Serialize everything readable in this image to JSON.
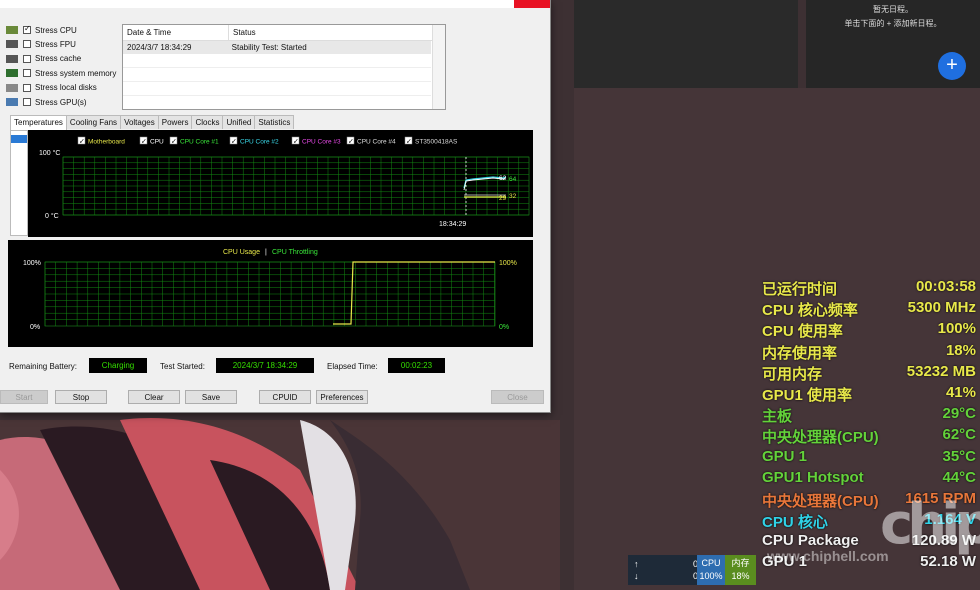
{
  "calendar": {
    "line1": "暂无日程。",
    "line2": "单击下面的 + 添加新日程。",
    "add_label": "+"
  },
  "overlay": {
    "rows": [
      {
        "label": "已运行时间",
        "value": "00:03:58",
        "color": "#e8e84a"
      },
      {
        "label": "CPU 核心频率",
        "value": "5300 MHz",
        "color": "#e8e84a"
      },
      {
        "label": "CPU 使用率",
        "value": "100%",
        "color": "#e8e84a"
      },
      {
        "label": "内存使用率",
        "value": "18%",
        "color": "#e8e84a"
      },
      {
        "label": "可用内存",
        "value": "53232 MB",
        "color": "#e8e84a"
      },
      {
        "label": "GPU1 使用率",
        "value": "41%",
        "color": "#e8e84a"
      },
      {
        "label": "主板",
        "value": "29°C",
        "color": "#63d23a"
      },
      {
        "label": "中央处理器(CPU)",
        "value": "62°C",
        "color": "#63d23a"
      },
      {
        "label": "GPU 1",
        "value": "35°C",
        "color": "#63d23a"
      },
      {
        "label": "GPU1 Hotspot",
        "value": "44°C",
        "color": "#63d23a"
      },
      {
        "label": "中央处理器(CPU)",
        "value": "1615 RPM",
        "color": "#e8763a"
      },
      {
        "label": "CPU 核心",
        "value": "1.164 V",
        "color": "#2fd3e8"
      },
      {
        "label": "CPU Package",
        "value": "120.89 W",
        "color": "#f0f0f0"
      },
      {
        "label": "GPU 1",
        "value": "52.18 W",
        "color": "#f0f0f0"
      }
    ]
  },
  "tray": {
    "up": "0.0M/s",
    "down": "0.0M/s",
    "cpu_label": "CPU",
    "cpu_value": "100%",
    "mem_label": "内存",
    "mem_value": "18%"
  },
  "watermark": {
    "url": "www.chiphell.com",
    "logo": "chip"
  },
  "stress": [
    {
      "label": "Stress CPU",
      "checked": true
    },
    {
      "label": "Stress FPU",
      "checked": false
    },
    {
      "label": "Stress cache",
      "checked": false
    },
    {
      "label": "Stress system memory",
      "checked": false
    },
    {
      "label": "Stress local disks",
      "checked": false
    },
    {
      "label": "Stress GPU(s)",
      "checked": false
    }
  ],
  "status_table": {
    "headers": [
      "Date & Time",
      "Status"
    ],
    "rows": [
      [
        "2024/3/7 18:34:29",
        "Stability Test: Started"
      ]
    ]
  },
  "tabs": [
    "Temperatures",
    "Cooling Fans",
    "Voltages",
    "Powers",
    "Clocks",
    "Unified",
    "Statistics"
  ],
  "temp_chart": {
    "legend": [
      {
        "name": "Motherboard",
        "color": "#e8e84a"
      },
      {
        "name": "CPU",
        "color": "#ffffff"
      },
      {
        "name": "CPU Core #1",
        "color": "#3ae83a"
      },
      {
        "name": "CPU Core #2",
        "color": "#3ad8e8"
      },
      {
        "name": "CPU Core #3",
        "color": "#e84ae8"
      },
      {
        "name": "CPU Core #4",
        "color": "#dddddd"
      },
      {
        "name": "ST3500418AS",
        "color": "#dddddd"
      }
    ],
    "ymax_label": "100 °C",
    "ymin_label": "0 °C",
    "time_label": "18:34:29",
    "values_right": [
      "62",
      "64",
      "29",
      "32"
    ]
  },
  "usage_chart": {
    "legend_a": "CPU Usage",
    "legend_sep": "|",
    "legend_b": "CPU Throttling",
    "left_top": "100%",
    "left_bottom": "0%",
    "right_top": "100%",
    "right_bottom": "0%"
  },
  "bottom": {
    "battery_label": "Remaining Battery:",
    "battery_value": "Charging",
    "started_label": "Test Started:",
    "started_value": "2024/3/7 18:34:29",
    "elapsed_label": "Elapsed Time:",
    "elapsed_value": "00:02:23"
  },
  "buttons": {
    "start": "Start",
    "stop": "Stop",
    "clear": "Clear",
    "save": "Save",
    "cpuid": "CPUID",
    "preferences": "Preferences",
    "close": "Close"
  }
}
